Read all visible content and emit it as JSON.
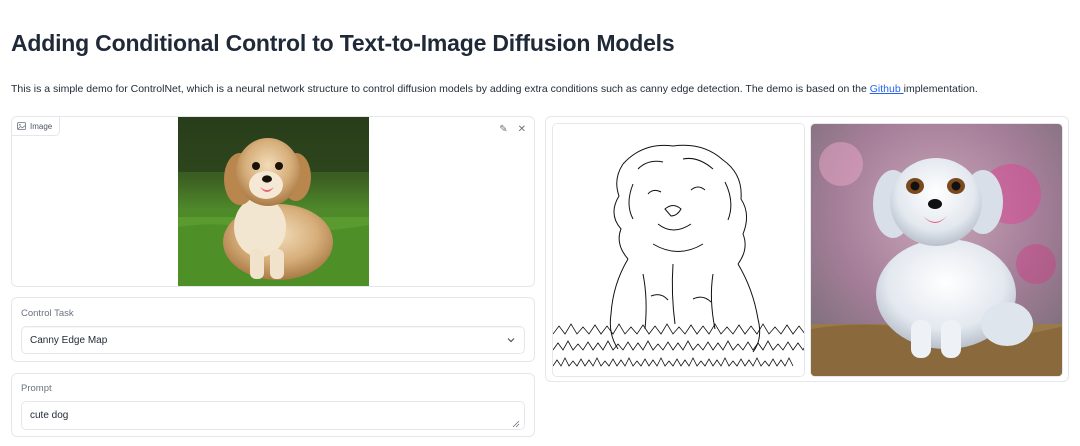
{
  "page": {
    "title": "Adding Conditional Control to Text-to-Image Diffusion Models",
    "description_before_link": "This is a simple demo for ControlNet, which is a neural network structure to control diffusion models by adding extra conditions such as canny edge detection. The demo is based on the ",
    "description_link": "Github ",
    "description_after_link": "implementation."
  },
  "image_input": {
    "label": "Image",
    "label_icon": "image-icon",
    "edit_icon": "pencil-icon",
    "clear_icon": "close-icon",
    "edit_glyph": "✎",
    "clear_glyph": "✕"
  },
  "control_task": {
    "label": "Control Task",
    "value": "Canny Edge Map",
    "icon": "chevron-down-icon"
  },
  "prompt": {
    "label": "Prompt",
    "value": "cute dog"
  },
  "gallery": {
    "items": [
      "canny-edge-result",
      "generated-dog-result"
    ]
  },
  "colors": {
    "link": "#2563eb",
    "border": "#e5e7eb",
    "label": "#6b7280"
  }
}
